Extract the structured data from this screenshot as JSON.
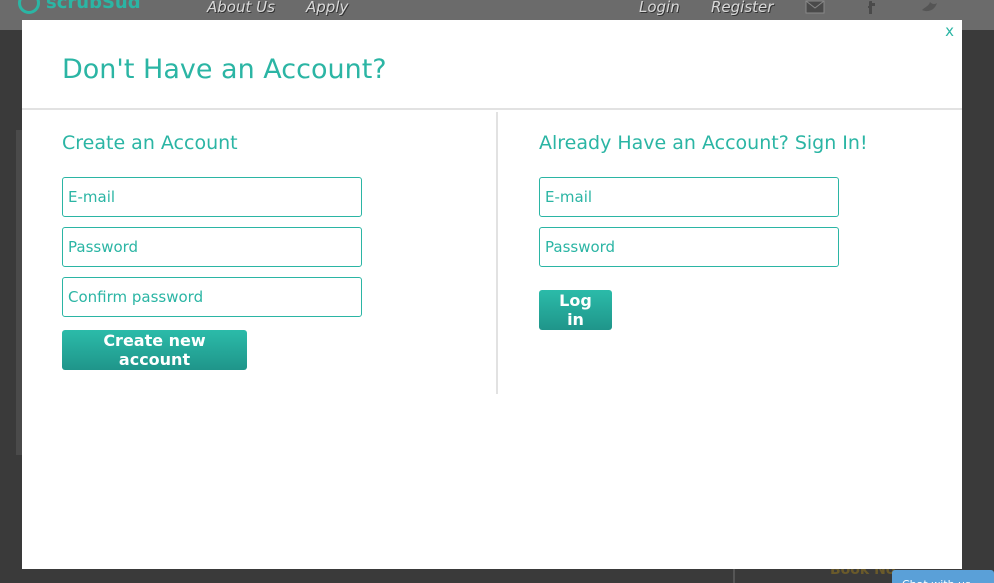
{
  "site": {
    "logo_text": "scrubSud",
    "nav_left": [
      "About Us",
      "Apply"
    ],
    "nav_right": [
      "Login",
      "Register"
    ],
    "icons": [
      "mail-icon",
      "facebook-icon",
      "twitter-icon"
    ],
    "background_link": "Book No",
    "chat_tab": "Chat with us"
  },
  "modal": {
    "close_label": "x",
    "title": "Don't Have an Account?",
    "create": {
      "heading": "Create an Account",
      "email_placeholder": "E-mail",
      "password_placeholder": "Password",
      "confirm_placeholder": "Confirm password",
      "button_label": "Create new account"
    },
    "signin": {
      "heading": "Already Have an Account? Sign In!",
      "email_placeholder": "E-mail",
      "password_placeholder": "Password",
      "button_label": "Log in"
    }
  },
  "colors": {
    "accent": "#2bb5a4",
    "overlay": "#3a3a3a"
  }
}
